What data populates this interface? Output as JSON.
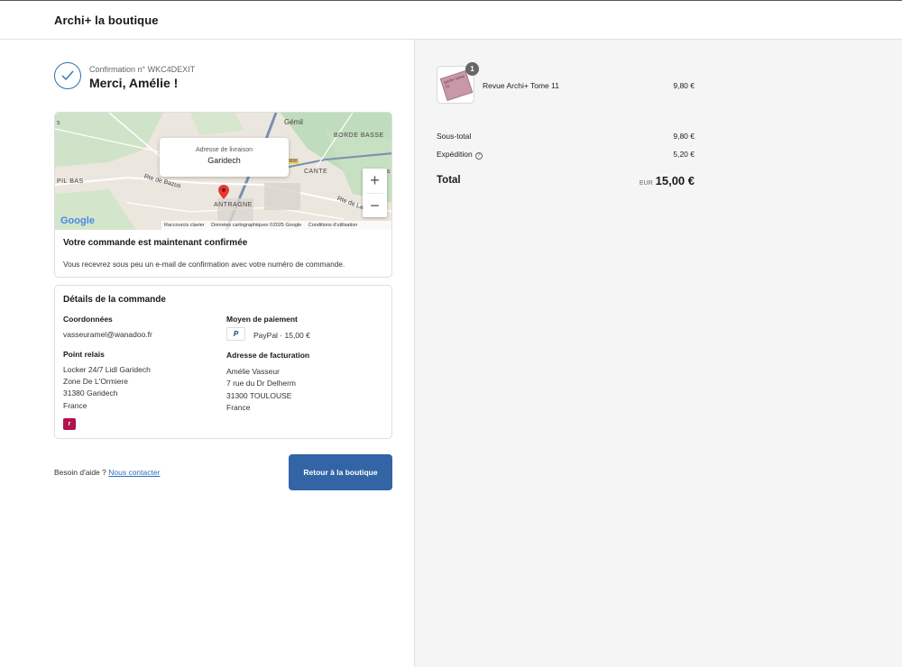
{
  "header": {
    "store_name": "Archi+ la boutique"
  },
  "confirmation": {
    "number_text": "Confirmation n° WKC4DEXIT",
    "title": "Merci, Amélie !"
  },
  "map": {
    "popup_label": "Adresse de livraison",
    "popup_value": "Garidech",
    "places": [
      "Gémil",
      "BORDE BASSE",
      "CANTE",
      "PIL BAS",
      "Rte de Bazus",
      "Rte de La",
      "ANTRAGNE",
      "s",
      "s",
      "S"
    ],
    "road_number": "D888",
    "zoom_in": "+",
    "zoom_out": "−",
    "google": "Google",
    "footer": {
      "shortcuts": "Raccourcis clavier",
      "data": "Données cartographiques ©2025 Google",
      "terms": "Conditions d'utilisation"
    }
  },
  "order_confirmed": {
    "title": "Votre commande est maintenant confirmée",
    "text": "Vous recevrez sous peu un e-mail de confirmation avec votre numéro de commande."
  },
  "details": {
    "title": "Détails de la commande",
    "contact_heading": "Coordonnées",
    "contact_email": "vasseuramel@wanadoo.fr",
    "relay_heading": "Point relais",
    "relay_lines": [
      "Locker 24/7 Lidl Garidech",
      "Zone De L'Ormiere",
      "31380 Garidech",
      "France"
    ],
    "relay_logo_text": "r",
    "payment_heading": "Moyen de paiement",
    "payment_icon": "P",
    "payment_text": "PayPal · 15,00 €",
    "billing_heading": "Adresse de facturation",
    "billing_lines": [
      "Amélie Vasseur",
      "7 rue du Dr Delherm",
      "31300 TOULOUSE",
      "France"
    ]
  },
  "footer": {
    "help_text": "Besoin d'aide ?",
    "contact_link": "Nous contacter",
    "return_button": "Retour à la boutique"
  },
  "summary": {
    "product": {
      "name": "Revue Archi+ Tome 11",
      "price": "9,80 €",
      "quantity": "1",
      "cover_text": "archi+ tome 11"
    },
    "subtotal_label": "Sous-total",
    "subtotal_value": "9,80 €",
    "shipping_label": "Expédition",
    "shipping_info_icon": "?",
    "shipping_value": "5,20 €",
    "total_label": "Total",
    "total_currency": "EUR",
    "total_value": "15,00 €"
  },
  "colors": {
    "accent": "#3264a6",
    "link": "#2f6fb5",
    "relay_brand": "#b0124e"
  }
}
